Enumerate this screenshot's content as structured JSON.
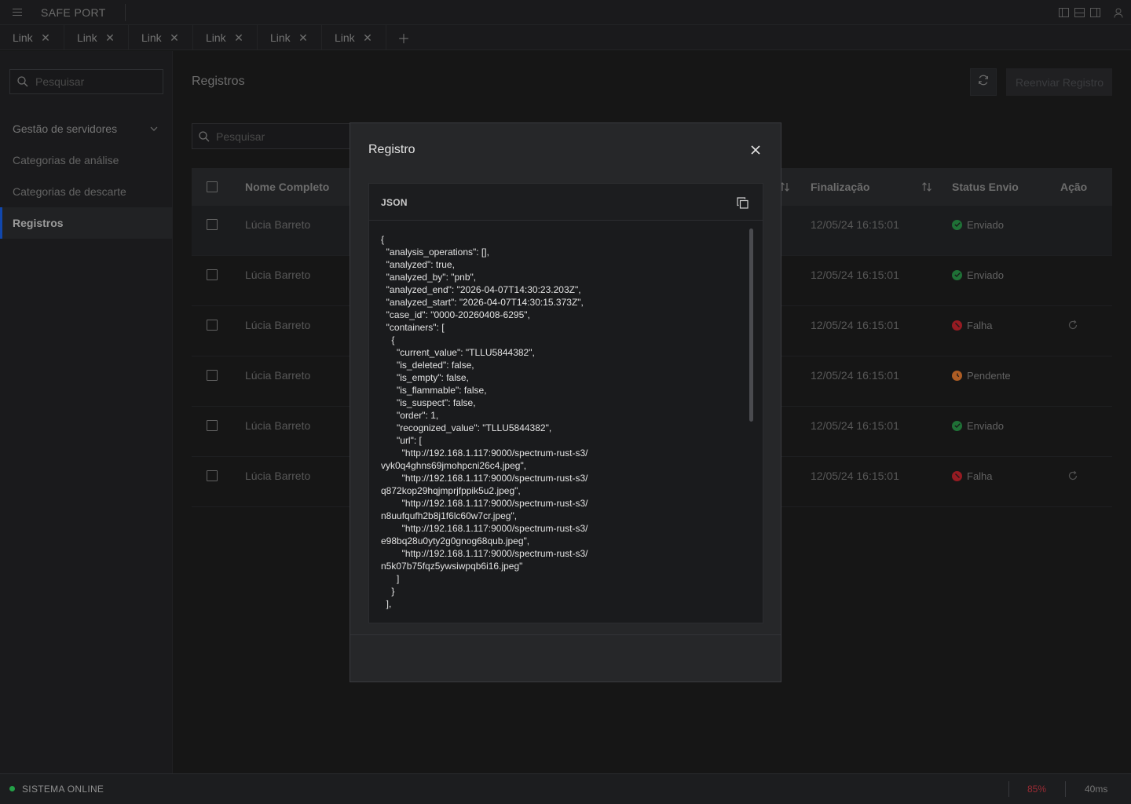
{
  "app": {
    "brand": "SAFE PORT"
  },
  "tabs": [
    {
      "label": "Link"
    },
    {
      "label": "Link"
    },
    {
      "label": "Link"
    },
    {
      "label": "Link"
    },
    {
      "label": "Link"
    },
    {
      "label": "Link"
    }
  ],
  "sidebar": {
    "search_placeholder": "Pesquisar",
    "items": [
      {
        "label": "Gestão de servidores"
      },
      {
        "label": "Categorias de análise"
      },
      {
        "label": "Categorias de descarte"
      },
      {
        "label": "Registros"
      }
    ]
  },
  "page": {
    "title": "Registros",
    "resend_label": "Reenviar Registro",
    "search_placeholder": "Pesquisar"
  },
  "table": {
    "headers": {
      "name": "Nome Completo",
      "finalization": "Finalização",
      "status": "Status Envio",
      "action": "Ação"
    },
    "rows": [
      {
        "name": "Lúcia Barreto",
        "date": "12/05/24 16:15:01",
        "status": "Enviado"
      },
      {
        "name": "Lúcia Barreto",
        "date": "12/05/24 16:15:01",
        "status": "Enviado"
      },
      {
        "name": "Lúcia Barreto",
        "date": "12/05/24 16:15:01",
        "status": "Falha"
      },
      {
        "name": "Lúcia Barreto",
        "date": "12/05/24 16:15:01",
        "status": "Pendente"
      },
      {
        "name": "Lúcia Barreto",
        "date": "12/05/24 16:15:01",
        "status": "Enviado"
      },
      {
        "name": "Lúcia Barreto",
        "date": "12/05/24 16:15:01",
        "status": "Falha"
      }
    ]
  },
  "modal": {
    "title": "Registro",
    "json_label": "JSON",
    "json_text": "{\n  \"analysis_operations\": [],\n  \"analyzed\": true,\n  \"analyzed_by\": \"pnb\",\n  \"analyzed_end\": \"2026-04-07T14:30:23.203Z\",\n  \"analyzed_start\": \"2026-04-07T14:30:15.373Z\",\n  \"case_id\": \"0000-20260408-6295\",\n  \"containers\": [\n    {\n      \"current_value\": \"TLLU5844382\",\n      \"is_deleted\": false,\n      \"is_empty\": false,\n      \"is_flammable\": false,\n      \"is_suspect\": false,\n      \"order\": 1,\n      \"recognized_value\": \"TLLU5844382\",\n      \"url\": [\n        \"http://192.168.1.117:9000/spectrum-rust-s3/\nvyk0q4ghns69jmohpcni26c4.jpeg\",\n        \"http://192.168.1.117:9000/spectrum-rust-s3/\nq872kop29hqjmprjfppik5u2.jpeg\",\n        \"http://192.168.1.117:9000/spectrum-rust-s3/\nn8uufqufh2b8j1f6lc60w7cr.jpeg\",\n        \"http://192.168.1.117:9000/spectrum-rust-s3/\ne98bq28u0yty2g0gnog68qub.jpeg\",\n        \"http://192.168.1.117:9000/spectrum-rust-s3/\nn5k07b75fqz5ywsiwpqb6i16.jpeg\"\n      ]\n    }\n  ],"
  },
  "statusbar": {
    "system": "SISTEMA ONLINE",
    "cpu": "85%",
    "latency": "40ms"
  },
  "colors": {
    "success": "#24a148",
    "failure": "#da1e28",
    "pending": "#ff832b",
    "accent": "#0f62fe"
  }
}
